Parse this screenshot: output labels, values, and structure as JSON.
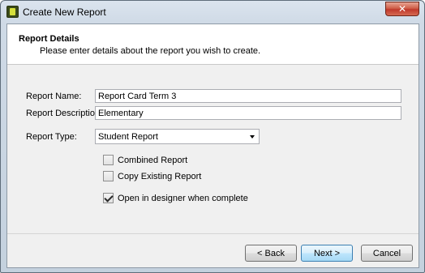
{
  "window": {
    "title": "Create New Report",
    "close_glyph": "✕"
  },
  "header": {
    "title": "Report Details",
    "subtitle": "Please enter details about the report you wish to create."
  },
  "form": {
    "name_label": "Report Name:",
    "name_value": "Report Card Term 3",
    "description_label": "Report Description:",
    "description_value": "Elementary",
    "type_label": "Report Type:",
    "type_value": "Student Report"
  },
  "options": {
    "combined_label": "Combined Report",
    "combined_checked": false,
    "copy_label": "Copy Existing Report",
    "copy_checked": false,
    "designer_label": "Open in designer when complete",
    "designer_checked": true
  },
  "buttons": {
    "back": "< Back",
    "next": "Next >",
    "cancel": "Cancel"
  }
}
